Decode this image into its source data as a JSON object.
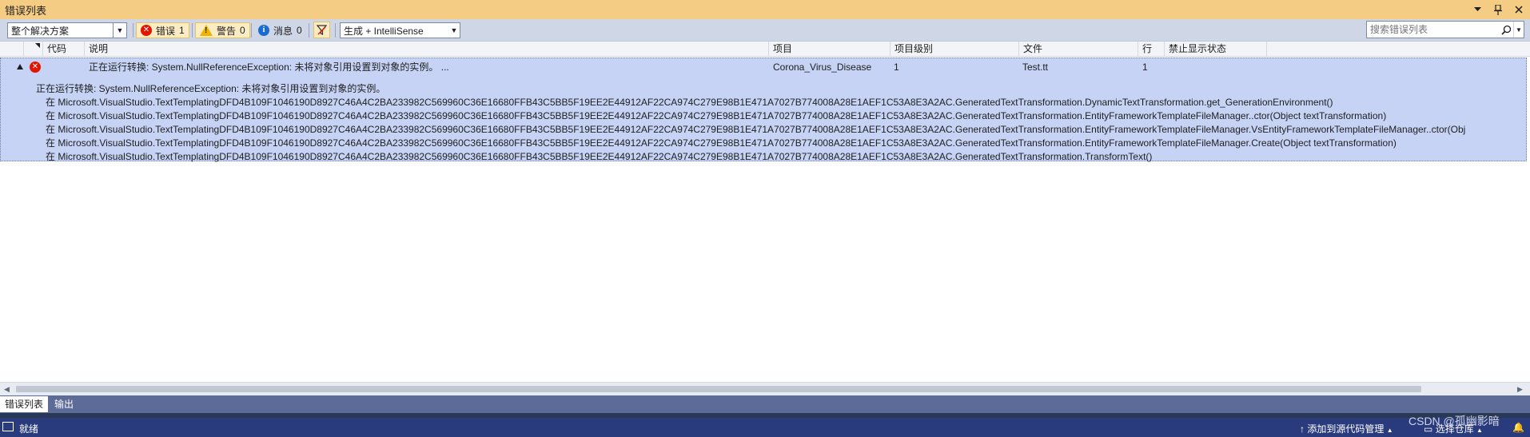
{
  "window": {
    "title": "错误列表"
  },
  "toolbar": {
    "scope_value": "整个解决方案",
    "errors_label": "错误",
    "errors_count": "1",
    "warnings_label": "警告",
    "warnings_count": "0",
    "messages_label": "消息",
    "messages_count": "0",
    "build_filter": "生成 + IntelliSense",
    "search_placeholder": "搜索错误列表"
  },
  "columns": {
    "code": "代码",
    "description": "说明",
    "project": "项目",
    "project_rank": "项目级别",
    "file": "文件",
    "line": "行",
    "suppression": "禁止显示状态"
  },
  "error_row": {
    "description": "正在运行转换: System.NullReferenceException: 未将对象引用设置到对象的实例。 ...",
    "project": "Corona_Virus_Disease",
    "project_rank": "1",
    "file": "Test.tt",
    "line": "1",
    "detail_header": "正在运行转换: System.NullReferenceException: 未将对象引用设置到对象的实例。",
    "stack": [
      "在 Microsoft.VisualStudio.TextTemplatingDFD4B109F1046190D8927C46A4C2BA233982C569960C36E16680FFB43C5BB5F19EE2E44912AF22CA974C279E98B1E471A7027B774008A28E1AEF1C53A8E3A2AC.GeneratedTextTransformation.DynamicTextTransformation.get_GenerationEnvironment()",
      "在 Microsoft.VisualStudio.TextTemplatingDFD4B109F1046190D8927C46A4C2BA233982C569960C36E16680FFB43C5BB5F19EE2E44912AF22CA974C279E98B1E471A7027B774008A28E1AEF1C53A8E3A2AC.GeneratedTextTransformation.EntityFrameworkTemplateFileManager..ctor(Object textTransformation)",
      "在 Microsoft.VisualStudio.TextTemplatingDFD4B109F1046190D8927C46A4C2BA233982C569960C36E16680FFB43C5BB5F19EE2E44912AF22CA974C279E98B1E471A7027B774008A28E1AEF1C53A8E3A2AC.GeneratedTextTransformation.EntityFrameworkTemplateFileManager.VsEntityFrameworkTemplateFileManager..ctor(Obj",
      "在 Microsoft.VisualStudio.TextTemplatingDFD4B109F1046190D8927C46A4C2BA233982C569960C36E16680FFB43C5BB5F19EE2E44912AF22CA974C279E98B1E471A7027B774008A28E1AEF1C53A8E3A2AC.GeneratedTextTransformation.EntityFrameworkTemplateFileManager.Create(Object textTransformation)",
      "在 Microsoft.VisualStudio.TextTemplatingDFD4B109F1046190D8927C46A4C2BA233982C569960C36E16680FFB43C5BB5F19EE2E44912AF22CA974C279E98B1E471A7027B774008A28E1AEF1C53A8E3A2AC.GeneratedTextTransformation.TransformText()"
    ]
  },
  "bottom_tabs": [
    "错误列表",
    "输出"
  ],
  "status": {
    "ready": "就绪",
    "add_source_control": "添加到源代码管理",
    "select_repo": "选择仓库"
  },
  "watermark": "CSDN @孤幽影暗",
  "colors": {
    "title_bar": "#f5cc84",
    "toolbar": "#cfd6e5",
    "selection": "#c6d3f5",
    "error": "#e51400",
    "warning": "#f0b400",
    "info": "#1c6bd3",
    "status_bar": "#293b7d"
  }
}
